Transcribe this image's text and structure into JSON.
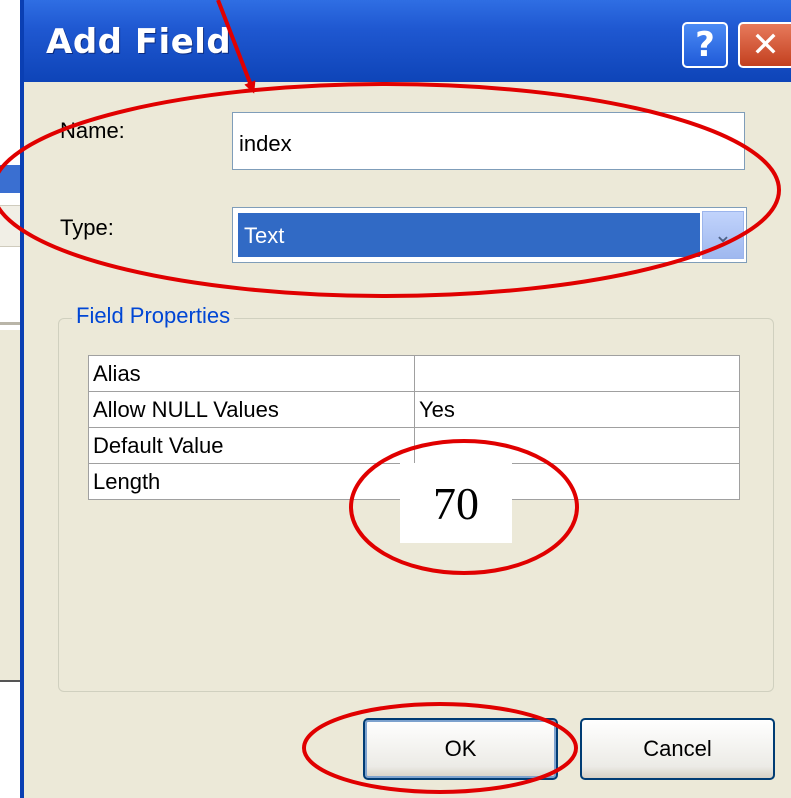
{
  "dialog": {
    "title": "Add Field",
    "help_button": "?",
    "close_button": "✕"
  },
  "form": {
    "name_label": "Name:",
    "name_value": "index",
    "type_label": "Type:",
    "type_value": "Text"
  },
  "field_properties": {
    "title": "Field Properties",
    "rows": [
      {
        "key": "Alias",
        "value": ""
      },
      {
        "key": "Allow NULL Values",
        "value": "Yes"
      },
      {
        "key": "Default Value",
        "value": ""
      },
      {
        "key": "Length",
        "value": ""
      }
    ],
    "length_annotation": "70"
  },
  "buttons": {
    "ok": "OK",
    "cancel": "Cancel"
  },
  "colors": {
    "annotation": "#e00000",
    "titlebar": "#0e44b8",
    "selection": "#316ac5"
  }
}
